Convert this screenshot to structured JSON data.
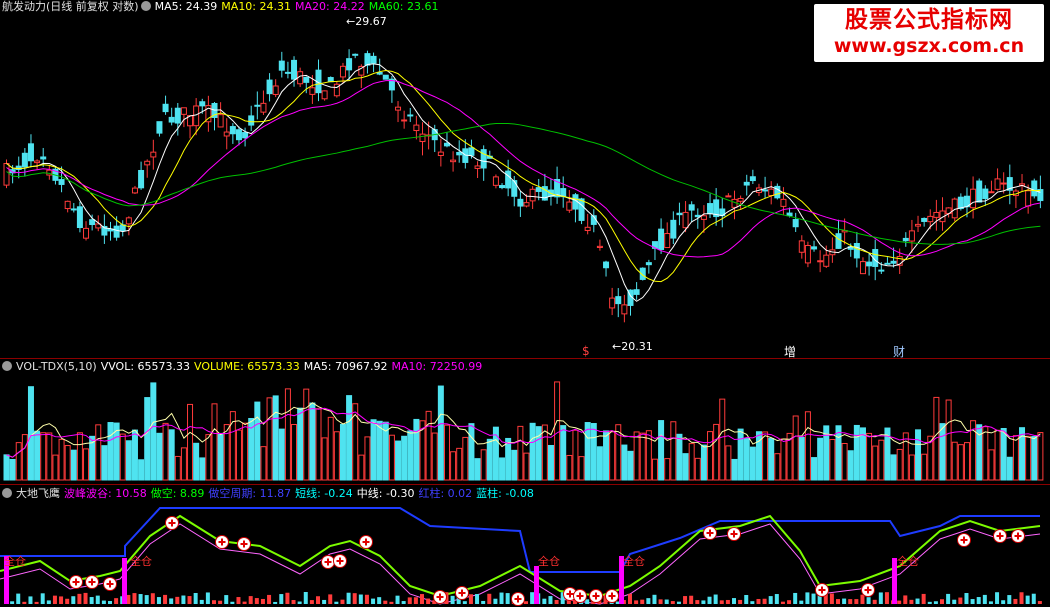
{
  "main_panel": {
    "title": "航发动力(日线 前复权 对数)",
    "indicators": [
      {
        "label": "MA5: 24.39",
        "color": "#ffffff"
      },
      {
        "label": "MA10: 24.31",
        "color": "#ffff00"
      },
      {
        "label": "MA20: 24.22",
        "color": "#ff00ff"
      },
      {
        "label": "MA60: 23.61",
        "color": "#00ff00"
      }
    ],
    "high_label": "29.67",
    "low_label": "20.31",
    "markers": [
      {
        "text": "$",
        "color": "#ff4040"
      },
      {
        "text": "增",
        "color": "#ffffff"
      },
      {
        "text": "财",
        "color": "#a0c8ff"
      }
    ]
  },
  "volume_panel": {
    "title": "VOL-TDX(5,10)",
    "indicators": [
      {
        "label": "VVOL: 65573.33",
        "color": "#ffffff"
      },
      {
        "label": "VOLUME: 65573.33",
        "color": "#ffff00"
      },
      {
        "label": "MA5: 70967.92",
        "color": "#ffffff"
      },
      {
        "label": "MA10: 72250.99",
        "color": "#ff00ff"
      }
    ]
  },
  "indicator_panel": {
    "title": "大地飞鹰",
    "indicators": [
      {
        "label": "波峰波谷: 10.58",
        "color": "#ff00ff"
      },
      {
        "label": "做空: 8.89",
        "color": "#00ff00"
      },
      {
        "label": "做空周期: 11.87",
        "color": "#4040ff"
      },
      {
        "label": "短线: -0.24",
        "color": "#00ffff"
      },
      {
        "label": "中线: -0.30",
        "color": "#ffffff"
      },
      {
        "label": "红柱: 0.02",
        "color": "#4040ff"
      },
      {
        "label": "蓝柱: -0.08",
        "color": "#00ffff"
      }
    ],
    "full_position_label": "全仓"
  },
  "watermark": {
    "line1": "股票公式指标网",
    "line2": "www.gszx.com.cn"
  },
  "icons": {
    "settings": "circle-gear-icon"
  }
}
